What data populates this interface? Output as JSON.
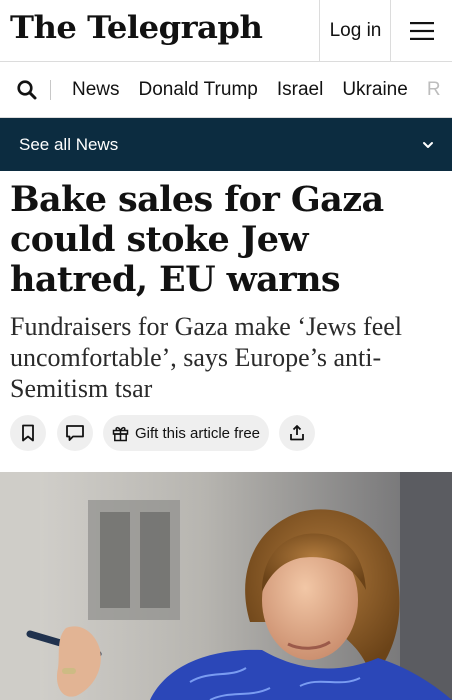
{
  "header": {
    "logo_text": "The Telegraph",
    "login_label": "Log in",
    "menu_icon": "hamburger-menu-icon"
  },
  "nav": {
    "search_icon": "search-icon",
    "items": [
      {
        "label": "News"
      },
      {
        "label": "Donald Trump"
      },
      {
        "label": "Israel"
      },
      {
        "label": "Ukraine"
      },
      {
        "label": "R"
      }
    ]
  },
  "section_bar": {
    "label": "See all News",
    "chevron_icon": "chevron-down-icon",
    "background": "#0c2c40"
  },
  "article": {
    "headline": "Bake sales for Gaza could stoke Jew hatred, EU warns",
    "standfirst": "Fundraisers for Gaza make ‘Jews feel uncomfortable’, says Europe’s anti-Semitism tsar",
    "actions": {
      "bookmark_icon": "bookmark-icon",
      "comment_icon": "comment-icon",
      "gift_label": "Gift this article free",
      "gift_icon": "gift-icon",
      "share_icon": "share-icon"
    }
  }
}
